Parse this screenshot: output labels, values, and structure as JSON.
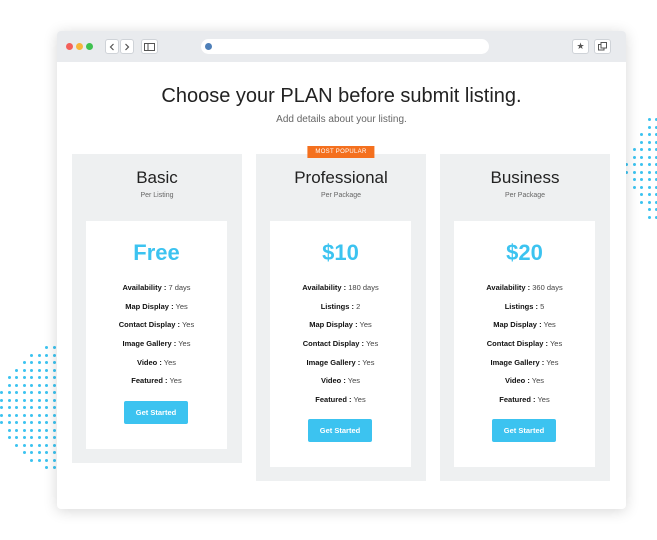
{
  "colors": {
    "accent": "#3cc3f0",
    "badge": "#f4701e",
    "panel": "#eef0f1",
    "toolbar": "#e9ebee",
    "traffic_red": "#f4605a",
    "traffic_yellow": "#f7b63a",
    "traffic_green": "#3fc150"
  },
  "browser": {
    "back_icon": "chevron-left-icon",
    "forward_icon": "chevron-right-icon",
    "sidebar_icon": "sidebar-icon",
    "bookmark_icon": "star-icon",
    "duplicate_icon": "duplicate-icon",
    "url_icon": "globe-icon"
  },
  "header": {
    "title": "Choose your PLAN before submit listing.",
    "subtitle": "Add details about your listing."
  },
  "plans": [
    {
      "name": "Basic",
      "unit": "Per Listing",
      "price": "Free",
      "badge": "",
      "features": [
        {
          "label": "Availability :",
          "value": "7 days"
        },
        {
          "label": "Map Display :",
          "value": "Yes"
        },
        {
          "label": "Contact Display :",
          "value": "Yes"
        },
        {
          "label": "Image Gallery :",
          "value": "Yes"
        },
        {
          "label": "Video :",
          "value": "Yes"
        },
        {
          "label": "Featured :",
          "value": "Yes"
        }
      ],
      "cta": "Get Started"
    },
    {
      "name": "Professional",
      "unit": "Per Package",
      "price": "$10",
      "badge": "MOST POPULAR",
      "features": [
        {
          "label": "Availability :",
          "value": "180 days"
        },
        {
          "label": "Listings :",
          "value": "2"
        },
        {
          "label": "Map Display :",
          "value": "Yes"
        },
        {
          "label": "Contact Display :",
          "value": "Yes"
        },
        {
          "label": "Image Gallery :",
          "value": "Yes"
        },
        {
          "label": "Video :",
          "value": "Yes"
        },
        {
          "label": "Featured :",
          "value": "Yes"
        }
      ],
      "cta": "Get Started"
    },
    {
      "name": "Business",
      "unit": "Per Package",
      "price": "$20",
      "badge": "",
      "features": [
        {
          "label": "Availability :",
          "value": "360 days"
        },
        {
          "label": "Listings :",
          "value": "5"
        },
        {
          "label": "Map Display :",
          "value": "Yes"
        },
        {
          "label": "Contact Display :",
          "value": "Yes"
        },
        {
          "label": "Image Gallery :",
          "value": "Yes"
        },
        {
          "label": "Video :",
          "value": "Yes"
        },
        {
          "label": "Featured :",
          "value": "Yes"
        }
      ],
      "cta": "Get Started"
    }
  ]
}
